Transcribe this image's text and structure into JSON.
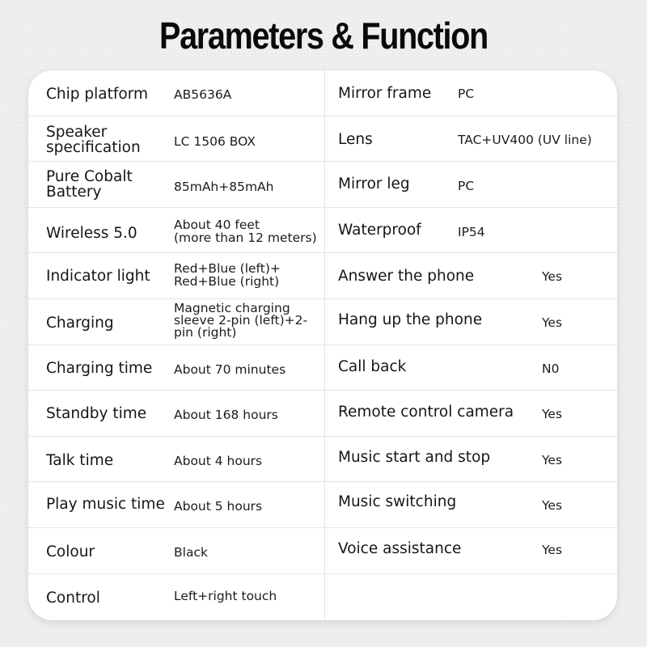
{
  "title": "Parameters & Function",
  "left_column": [
    {
      "label": "Chip platform",
      "value": "AB5636A"
    },
    {
      "label": "Speaker specification",
      "label_lines": [
        "Speaker",
        "specification"
      ],
      "value": "LC  1506 BOX"
    },
    {
      "label": "Pure Cobalt Battery",
      "label_lines": [
        "Pure Cobalt",
        "Battery"
      ],
      "value": "85mAh+85mAh"
    },
    {
      "label": "Wireless 5.0",
      "value": "About 40 feet (more than 12 meters)",
      "value_lines": [
        "About 40 feet",
        "(more than 12 meters)"
      ]
    },
    {
      "label": "Indicator light",
      "value": "Red+Blue (left)+ Red+Blue (right)",
      "value_lines": [
        "Red+Blue (left)+",
        "Red+Blue (right)"
      ]
    },
    {
      "label": "Charging",
      "value": "Magnetic charging sleeve 2-pin (left)+2-pin (right)",
      "value_lines": [
        "Magnetic charging",
        "sleeve 2-pin (left)+2-",
        "pin (right)"
      ]
    },
    {
      "label": "Charging time",
      "value": "About 70 minutes"
    },
    {
      "label": "Standby time",
      "value": "About 168 hours"
    },
    {
      "label": "Talk time",
      "value": "About 4 hours"
    },
    {
      "label": "Play music time",
      "value": "About 5 hours"
    },
    {
      "label": "Colour",
      "value": "Black"
    },
    {
      "label": "Control",
      "value": "Left+right touch"
    }
  ],
  "right_column": [
    {
      "label": "Mirror frame",
      "value": "PC"
    },
    {
      "label": "Lens",
      "value": "TAC+UV400 (UV line)"
    },
    {
      "label": "Mirror leg",
      "value": "PC"
    },
    {
      "label": "Waterproof",
      "value": "IP54"
    },
    {
      "label": "Answer the phone",
      "value": "Yes"
    },
    {
      "label": "Hang up the phone",
      "value": "Yes"
    },
    {
      "label": "Call back",
      "value": "N0"
    },
    {
      "label": "Remote control camera",
      "value": "Yes"
    },
    {
      "label": "Music start and stop",
      "value": "Yes"
    },
    {
      "label": "Music switching",
      "value": "Yes"
    },
    {
      "label": "Voice assistance",
      "value": "Yes"
    },
    {
      "label": "",
      "value": ""
    }
  ]
}
